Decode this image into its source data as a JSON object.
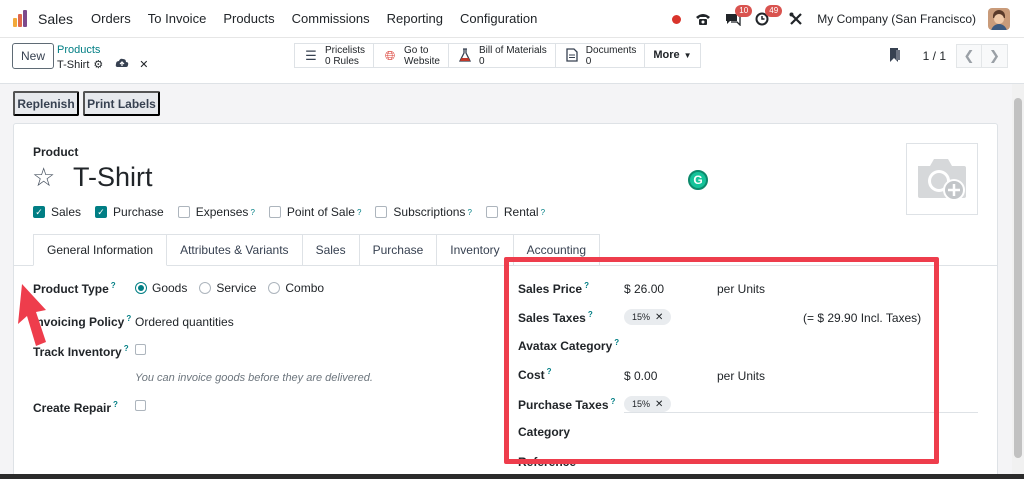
{
  "navbar": {
    "app_name": "Sales",
    "menu": [
      "Orders",
      "To Invoice",
      "Products",
      "Commissions",
      "Reporting",
      "Configuration"
    ],
    "messages_count": "10",
    "activities_count": "49",
    "company": "My Company (San Francisco)"
  },
  "control": {
    "new_label": "New",
    "breadcrumb": "Products",
    "record_name": "T-Shirt",
    "stats": [
      {
        "icon": "list-icon",
        "line1": "Pricelists",
        "line2": "0 Rules"
      },
      {
        "icon": "globe-icon",
        "line1": "Go to",
        "line2": "Website"
      },
      {
        "icon": "flask-icon",
        "line1": "Bill of Materials",
        "line2": "0"
      },
      {
        "icon": "document-icon",
        "line1": "Documents",
        "line2": "0"
      }
    ],
    "more_label": "More",
    "pager_value": "1 / 1"
  },
  "actions": {
    "replenish": "Replenish",
    "print_labels": "Print Labels"
  },
  "form": {
    "product_label": "Product",
    "title": "T-Shirt",
    "checks": [
      {
        "label": "Sales",
        "checked": true,
        "help": false
      },
      {
        "label": "Purchase",
        "checked": true,
        "help": false
      },
      {
        "label": "Expenses",
        "checked": false,
        "help": true
      },
      {
        "label": "Point of Sale",
        "checked": false,
        "help": true
      },
      {
        "label": "Subscriptions",
        "checked": false,
        "help": true
      },
      {
        "label": "Rental",
        "checked": false,
        "help": true
      }
    ],
    "tabs": [
      "General Information",
      "Attributes & Variants",
      "Sales",
      "Purchase",
      "Inventory",
      "Accounting"
    ],
    "left": {
      "product_type_label": "Product Type",
      "product_type_options": [
        "Goods",
        "Service",
        "Combo"
      ],
      "product_type_selected": "Goods",
      "invoicing_policy_label": "Invoicing Policy",
      "invoicing_policy_value": "Ordered quantities",
      "track_inventory_label": "Track Inventory",
      "hint": "You can invoice goods before they are delivered.",
      "create_repair_label": "Create Repair"
    },
    "right": {
      "sales_price_label": "Sales Price",
      "sales_price_value": "$ 26.00",
      "sales_price_unit": "per Units",
      "sales_taxes_label": "Sales Taxes",
      "sales_tax_tag": "15%",
      "sales_taxes_incl": "(= $ 29.90 Incl. Taxes)",
      "avatax_label": "Avatax Category",
      "cost_label": "Cost",
      "cost_value": "$ 0.00",
      "cost_unit": "per Units",
      "purchase_taxes_label": "Purchase Taxes",
      "purchase_tax_tag": "15%",
      "category_label": "Category",
      "reference_label": "Reference"
    }
  },
  "colors": {
    "accent": "#017e84",
    "highlight": "#ee3d4c"
  }
}
